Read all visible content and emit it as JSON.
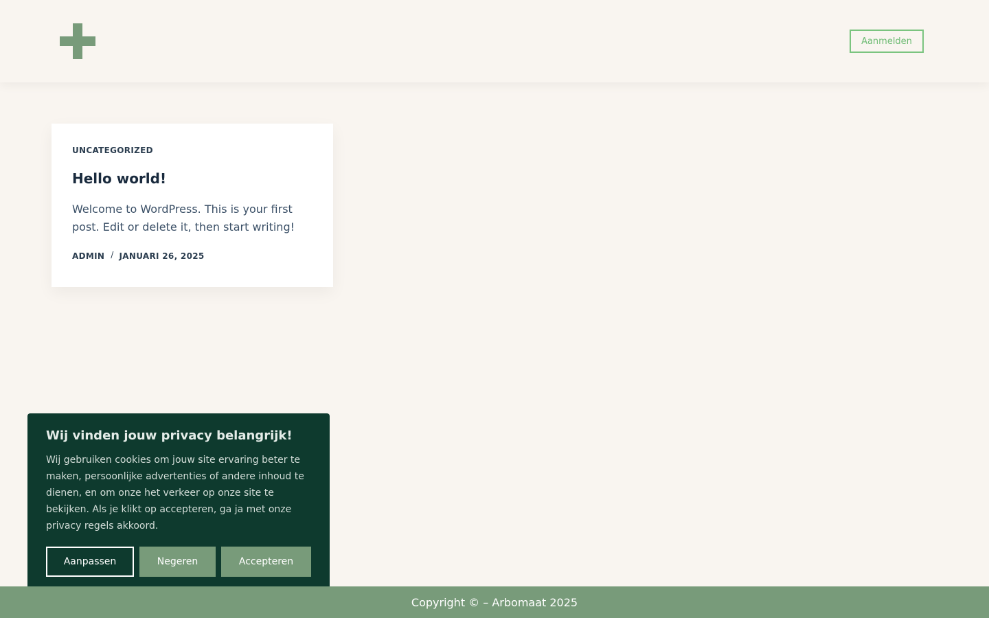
{
  "colors": {
    "background": "#f9f5f0",
    "brand_green": "#789b7a",
    "login_green": "#6dbb73",
    "cookie_bg": "#0e3a2e",
    "heading_dark": "#192a3d"
  },
  "header": {
    "logo_icon": "plus-icon",
    "login_label": "Aanmelden"
  },
  "post": {
    "category": "UNCATEGORIZED",
    "title": "Hello world!",
    "excerpt": "Welcome to WordPress. This is your first post. Edit or delete it, then start writing!",
    "author": "ADMIN",
    "separator": "/",
    "date": "JANUARI 26, 2025"
  },
  "cookie_banner": {
    "title": "Wij vinden jouw privacy belangrijk!",
    "text": "Wij gebruiken cookies om jouw site ervaring beter te maken, persoonlijke advertenties of andere inhoud te dienen, en om onze het verkeer op onze site te bekijken. Als je klikt op accepteren, ga ja met onze privacy regels akkoord.",
    "customize_label": "Aanpassen",
    "reject_label": "Negeren",
    "accept_label": "Accepteren"
  },
  "footer": {
    "copyright": "Copyright © – Arbomaat 2025"
  }
}
